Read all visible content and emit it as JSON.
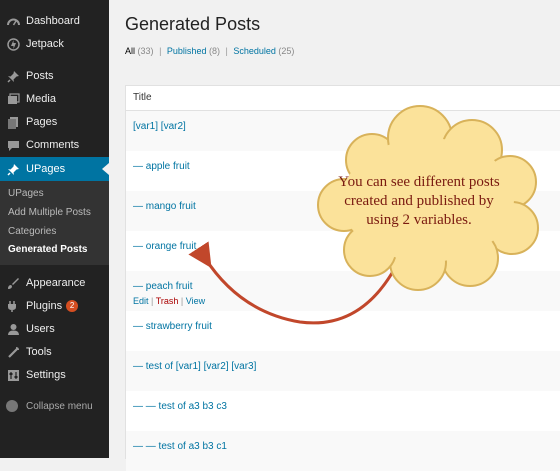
{
  "sidebar": {
    "items": [
      {
        "label": "Dashboard",
        "icon": "dashboard-icon"
      },
      {
        "label": "Jetpack",
        "icon": "jetpack-icon"
      },
      {
        "label": "Posts",
        "icon": "pin-icon"
      },
      {
        "label": "Media",
        "icon": "media-icon"
      },
      {
        "label": "Pages",
        "icon": "pages-icon"
      },
      {
        "label": "Comments",
        "icon": "comment-icon"
      },
      {
        "label": "UPages",
        "icon": "pin-icon"
      },
      {
        "label": "Appearance",
        "icon": "brush-icon"
      },
      {
        "label": "Plugins",
        "icon": "plugin-icon",
        "badge": "2"
      },
      {
        "label": "Users",
        "icon": "user-icon"
      },
      {
        "label": "Tools",
        "icon": "wrench-icon"
      },
      {
        "label": "Settings",
        "icon": "settings-icon"
      }
    ],
    "submenu": [
      "UPages",
      "Add Multiple Posts",
      "Categories",
      "Generated Posts"
    ],
    "collapse_label": "Collapse menu"
  },
  "main": {
    "title": "Generated Posts",
    "filters": {
      "all": "All",
      "all_count": "(33)",
      "published": "Published",
      "published_count": "(8)",
      "scheduled": "Scheduled",
      "scheduled_count": "(25)"
    },
    "table": {
      "column_title": "Title",
      "rows": [
        "[var1] [var2]",
        "— apple fruit",
        "— mango fruit",
        "— orange fruit",
        "— peach fruit",
        "— strawberry fruit",
        "— test of [var1] [var2] [var3]",
        "— — test of a3 b3 c3",
        "— — test of a3 b3 c1"
      ],
      "row_actions": {
        "edit": "Edit",
        "trash": "Trash",
        "view": "View"
      }
    }
  },
  "callout": {
    "text": "You can see different posts created and published by using 2 variables.",
    "fill_color": "#fbe29a",
    "stroke_color": "#d8b25a",
    "arrow_color": "#c1472b"
  },
  "colors": {
    "sidebar_bg": "#222222",
    "active_bg": "#0074a2",
    "link": "#0074a2",
    "trash": "#aa0000"
  }
}
